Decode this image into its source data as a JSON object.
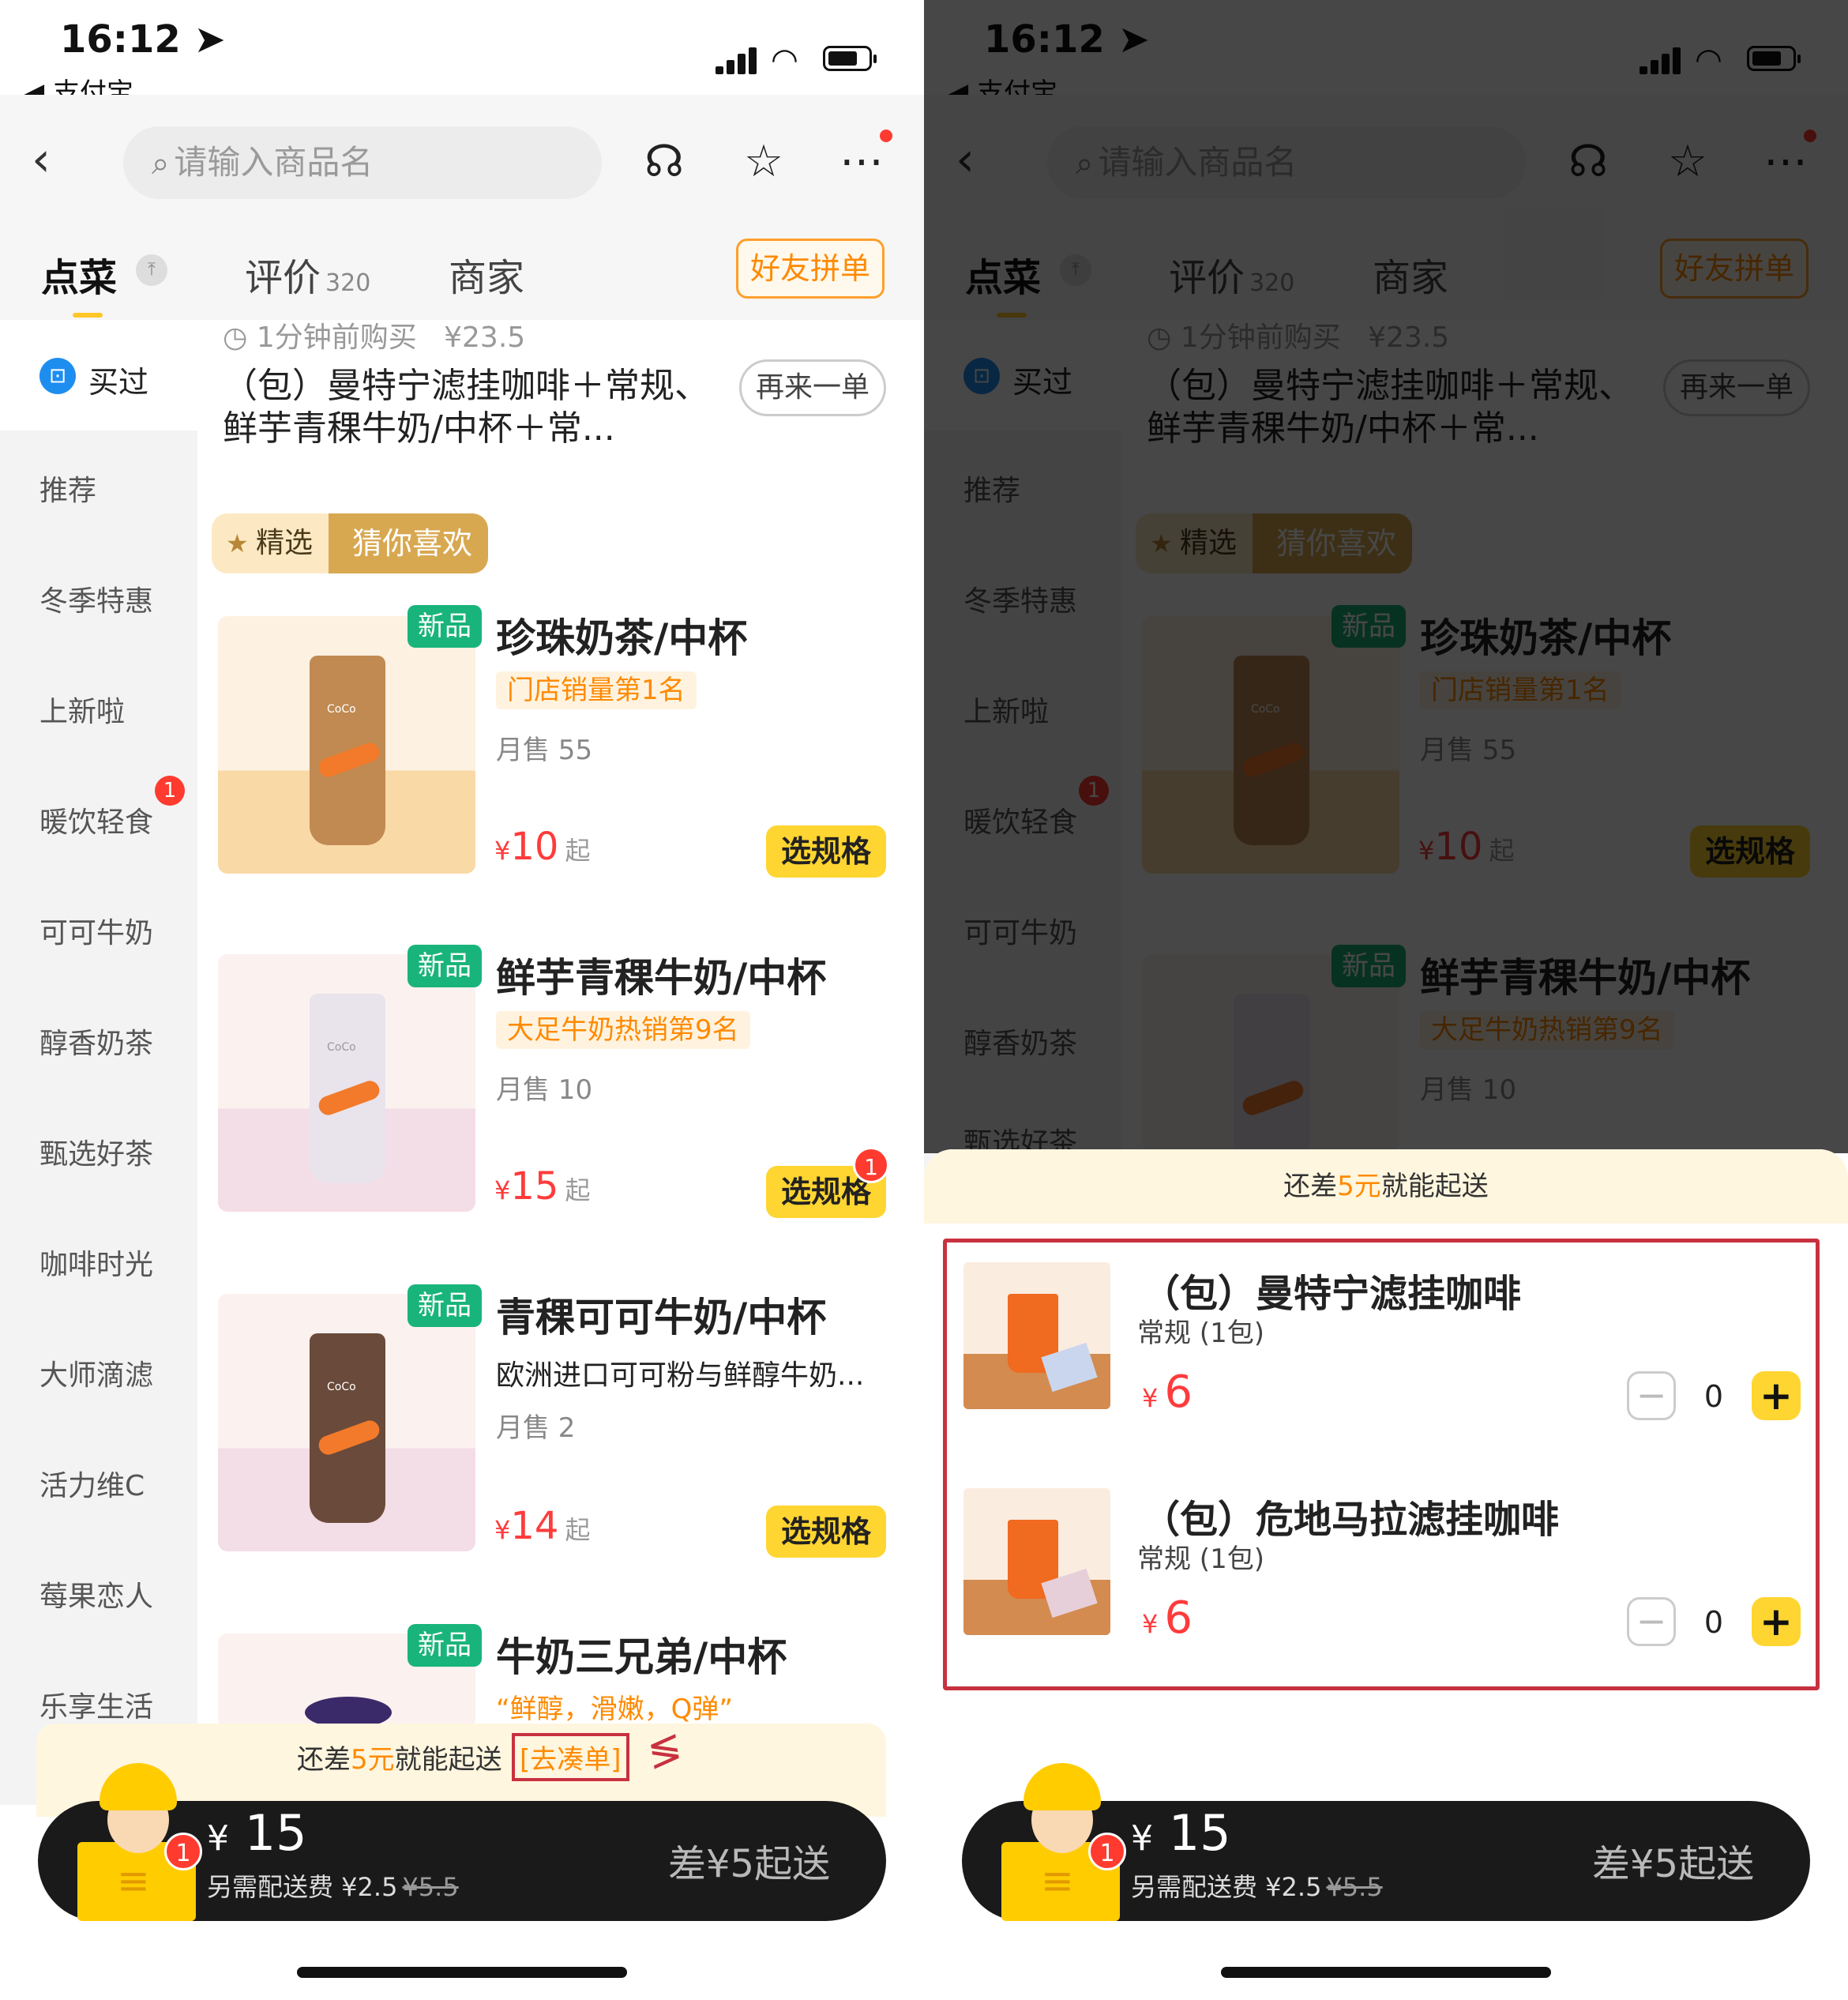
{
  "status": {
    "time": "16:12 ➤",
    "back_app": "◀ 支付宝"
  },
  "search": {
    "placeholder": "请输入商品名"
  },
  "tabs": [
    {
      "label": "点菜"
    },
    {
      "label": "评价",
      "count": "320"
    },
    {
      "label": "商家"
    }
  ],
  "friend_order": "好友拼单",
  "sidebar": {
    "bought": "买过",
    "items": [
      "推荐",
      "冬季特惠",
      "上新啦",
      "暖饮轻食",
      "可可牛奶",
      "醇香奶茶",
      "甄选好茶",
      "咖啡时光",
      "大师滴滤",
      "活力维C",
      "莓果恋人",
      "乐享生活"
    ],
    "badge": "1"
  },
  "reorder": {
    "time": "1分钟前购买",
    "price": "¥23.5",
    "name": "（包）曼特宁滤挂咖啡＋常规、 鲜芋青稞牛奶/中杯＋常...",
    "button": "再来一单"
  },
  "section_tag": {
    "left": "精选",
    "right": "猜你喜欢"
  },
  "products": [
    {
      "new": "新品",
      "name": "珍珠奶茶/中杯",
      "tag": "门店销量第1名",
      "sold": "月售 55",
      "price": "10",
      "from": "起",
      "button": "选规格"
    },
    {
      "new": "新品",
      "name": "鲜芋青稞牛奶/中杯",
      "tag": "大足牛奶热销第9名",
      "sold": "月售 10",
      "price": "15",
      "from": "起",
      "button": "选规格",
      "badge": "1"
    },
    {
      "new": "新品",
      "name": "青稞可可牛奶/中杯",
      "desc": "欧洲进口可可粉与鲜醇牛奶...",
      "sold": "月售 2",
      "price": "14",
      "from": "起",
      "button": "选规格"
    },
    {
      "new": "新品",
      "name": "牛奶三兄弟/中杯",
      "tag": "“鲜醇，滑嫩，Q弹”"
    }
  ],
  "currency": "¥",
  "tip": {
    "prefix": "还差",
    "amount": "5元",
    "suffix": "就能起送",
    "link": "[去凑单]"
  },
  "cart": {
    "badge": "1",
    "price": "15",
    "fee_label": "另需配送费 ¥2.5",
    "fee_old": "¥5.5",
    "right": "差¥5起送"
  },
  "basket": [
    {
      "name": "（包）曼特宁滤挂咖啡",
      "spec": "常规 (1包)",
      "price": "6",
      "qty": "0"
    },
    {
      "name": "（包）危地马拉滤挂咖啡",
      "spec": "常规 (1包)",
      "price": "6",
      "qty": "0"
    }
  ],
  "colors": {
    "accent": "#ffd531",
    "price": "#ff3b3b",
    "new_tag": "#19b47b",
    "orange": "#ff8a00",
    "highlight": "#c8313f"
  }
}
